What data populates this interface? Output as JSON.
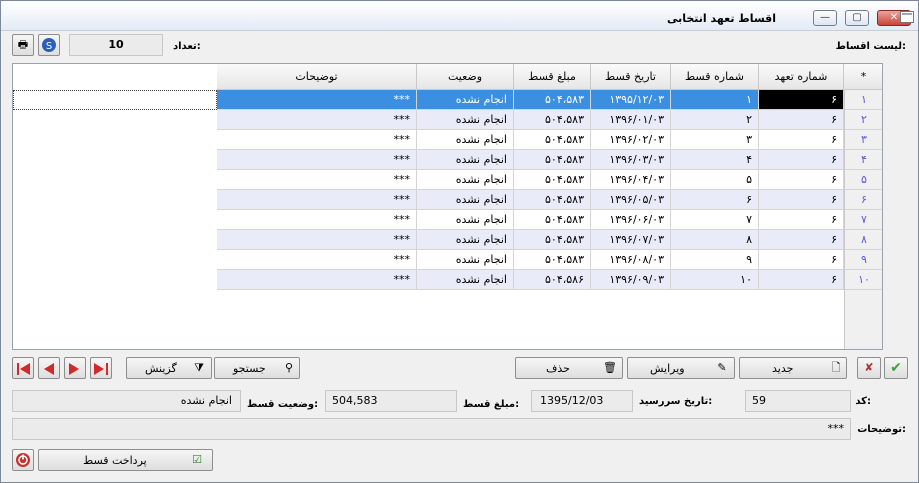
{
  "window": {
    "title": "اقساط تعهد انتخابی",
    "minimize": "—",
    "restore": "▢",
    "close": "✕"
  },
  "top": {
    "list_label": "لیست اقساط:",
    "count_label": "تعداد:",
    "count_value": "10"
  },
  "grid": {
    "corner": "*",
    "columns": [
      "شماره تعهد",
      "شماره قسط",
      "تاریخ قسط",
      "مبلغ قسط",
      "وضعیت",
      "توضیحات"
    ],
    "rows": [
      {
        "n": "۱",
        "commit": "۶",
        "inst": "۱",
        "date": "۱۳۹۵/۱۲/۰۳",
        "amount": "۵۰۴،۵۸۳",
        "status": "انجام نشده",
        "desc": "***"
      },
      {
        "n": "۲",
        "commit": "۶",
        "inst": "۲",
        "date": "۱۳۹۶/۰۱/۰۳",
        "amount": "۵۰۴،۵۸۳",
        "status": "انجام نشده",
        "desc": "***"
      },
      {
        "n": "۳",
        "commit": "۶",
        "inst": "۳",
        "date": "۱۳۹۶/۰۲/۰۳",
        "amount": "۵۰۴،۵۸۳",
        "status": "انجام نشده",
        "desc": "***"
      },
      {
        "n": "۴",
        "commit": "۶",
        "inst": "۴",
        "date": "۱۳۹۶/۰۳/۰۳",
        "amount": "۵۰۴،۵۸۳",
        "status": "انجام نشده",
        "desc": "***"
      },
      {
        "n": "۵",
        "commit": "۶",
        "inst": "۵",
        "date": "۱۳۹۶/۰۴/۰۳",
        "amount": "۵۰۴،۵۸۳",
        "status": "انجام نشده",
        "desc": "***"
      },
      {
        "n": "۶",
        "commit": "۶",
        "inst": "۶",
        "date": "۱۳۹۶/۰۵/۰۳",
        "amount": "۵۰۴،۵۸۳",
        "status": "انجام نشده",
        "desc": "***"
      },
      {
        "n": "۷",
        "commit": "۶",
        "inst": "۷",
        "date": "۱۳۹۶/۰۶/۰۳",
        "amount": "۵۰۴،۵۸۳",
        "status": "انجام نشده",
        "desc": "***"
      },
      {
        "n": "۸",
        "commit": "۶",
        "inst": "۸",
        "date": "۱۳۹۶/۰۷/۰۳",
        "amount": "۵۰۴،۵۸۳",
        "status": "انجام نشده",
        "desc": "***"
      },
      {
        "n": "۹",
        "commit": "۶",
        "inst": "۹",
        "date": "۱۳۹۶/۰۸/۰۳",
        "amount": "۵۰۴،۵۸۳",
        "status": "انجام نشده",
        "desc": "***"
      },
      {
        "n": "۱۰",
        "commit": "۶",
        "inst": "۱۰",
        "date": "۱۳۹۶/۰۹/۰۳",
        "amount": "۵۰۴،۵۸۶",
        "status": "انجام نشده",
        "desc": "***"
      }
    ]
  },
  "toolbar": {
    "new": "جدید",
    "edit": "ویرایش",
    "delete": "حذف",
    "search": "جستجو",
    "filter": "گزینش"
  },
  "detail": {
    "code_label": "کد:",
    "code": "59",
    "due_label": "تاریخ سررسید:",
    "due": "1395/12/03",
    "amount_label": "مبلغ قسط:",
    "amount": "504,583",
    "status_label": "وضعیت قسط:",
    "status": "انجام نشده",
    "desc_label": "توضیحات:",
    "desc": "***"
  },
  "bottom": {
    "pay": "پرداخت قسط"
  },
  "colors": {
    "selected_row": "#3c8fe0",
    "alt_row": "#e9ecf8",
    "row_number": "#5a5adc",
    "nav_arrow": "#d02a2a"
  }
}
